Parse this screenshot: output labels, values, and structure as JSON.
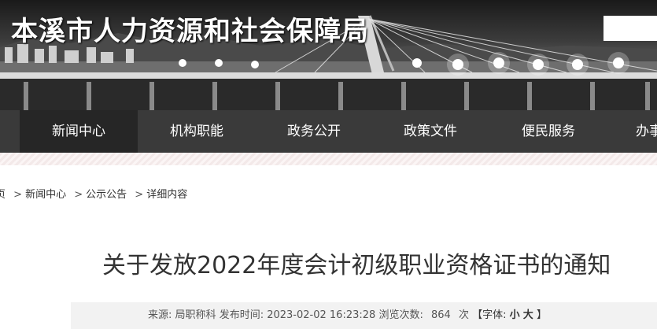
{
  "header": {
    "site_title": "本溪市人力资源和社会保障局"
  },
  "nav": {
    "items": [
      {
        "label": "新闻中心",
        "active": true
      },
      {
        "label": "机构职能",
        "active": false
      },
      {
        "label": "政务公开",
        "active": false
      },
      {
        "label": "政策文件",
        "active": false
      },
      {
        "label": "便民服务",
        "active": false
      },
      {
        "label": "办事",
        "active": false
      }
    ]
  },
  "breadcrumb": {
    "home": "页",
    "items": [
      "新闻中心",
      "公示公告",
      "详细内容"
    ],
    "separator": ">"
  },
  "article": {
    "title": "关于发放2022年度会计初级职业资格证书的通知",
    "source_label": "来源:",
    "source_value": "局职称科",
    "publish_label": "发布时间:",
    "publish_value": "2023-02-02 16:23:28",
    "views_label": "浏览次数:",
    "views_value": "864",
    "views_unit": "次",
    "font_open": "【字体:",
    "font_small": "小",
    "font_large": "大",
    "font_close": "】"
  },
  "colors": {
    "nav_bg": "#3a3a3a",
    "nav_active_bg": "#262626",
    "meta_bg": "#f2f2f2"
  }
}
